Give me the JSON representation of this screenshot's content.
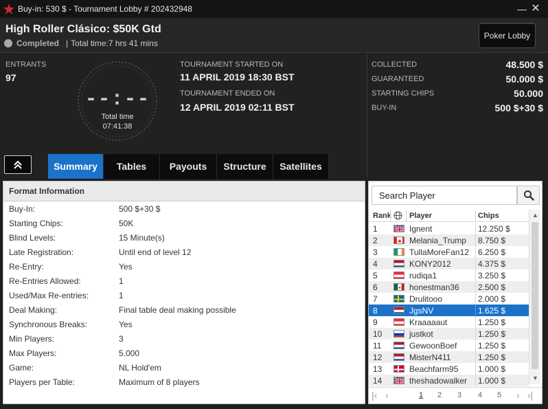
{
  "window": {
    "title": "Buy-in: 530 $ - Tournament Lobby # 202432948",
    "minimize": "—",
    "close": "✕"
  },
  "header": {
    "tournament_name": "High Roller Clásico: $50K Gtd",
    "status": "Completed",
    "separator": "|",
    "total_time": "Total time:7 hrs  41 mins",
    "poker_lobby_button": "Poker Lobby"
  },
  "info": {
    "entrants_label": "ENTRANTS",
    "entrants_value": "97",
    "clock_digits": "--:--",
    "clock_label": "Total time",
    "clock_value": "07:41:38",
    "started_label": "TOURNAMENT STARTED ON",
    "started_value": "11 APRIL 2019  18:30 BST",
    "ended_label": "TOURNAMENT ENDED ON",
    "ended_value": "12 APRIL 2019  02:11 BST"
  },
  "stats": [
    {
      "label": "COLLECTED",
      "value": "48.500 $"
    },
    {
      "label": "GUARANTEED",
      "value": "50.000 $"
    },
    {
      "label": "STARTING CHIPS",
      "value": "50.000"
    },
    {
      "label": "BUY-IN",
      "value": "500 $+30 $"
    }
  ],
  "tabs": [
    {
      "label": "Summary",
      "active": true
    },
    {
      "label": "Tables"
    },
    {
      "label": "Payouts"
    },
    {
      "label": "Structure"
    },
    {
      "label": "Satellites"
    }
  ],
  "format": {
    "title": "Format Information",
    "rows": [
      {
        "key": "Buy-In:",
        "value": "500 $+30 $"
      },
      {
        "key": "Starting Chips:",
        "value": "50K"
      },
      {
        "key": "Blind Levels:",
        "value": "15 Minute(s)"
      },
      {
        "key": "Late Registration:",
        "value": "Until end of level 12"
      },
      {
        "key": "Re-Entry:",
        "value": "Yes"
      },
      {
        "key": "Re-Entries Allowed:",
        "value": "1"
      },
      {
        "key": "Used/Max Re-entries:",
        "value": "1"
      },
      {
        "key": "Deal Making:",
        "value": "Final table deal making possible"
      },
      {
        "key": "Synchronous Breaks:",
        "value": "Yes"
      },
      {
        "key": "Min Players:",
        "value": "3"
      },
      {
        "key": "Max Players:",
        "value": "5.000"
      },
      {
        "key": "Game:",
        "value": "NL Hold'em"
      },
      {
        "key": "Players per Table:",
        "value": "Maximum of 8 players"
      }
    ]
  },
  "players": {
    "search_placeholder": "Search Player",
    "columns": {
      "rank": "Rank",
      "player": "Player",
      "chips": "Chips"
    },
    "rows": [
      {
        "rank": "1",
        "flag": "gb",
        "name": "Ignent",
        "chips": "12.250 $"
      },
      {
        "rank": "2",
        "flag": "ca",
        "name": "Melania_Trump",
        "chips": "8.750 $"
      },
      {
        "rank": "3",
        "flag": "ie",
        "name": "TullaMoreFan12",
        "chips": "6.250 $"
      },
      {
        "rank": "4",
        "flag": "nl",
        "name": "KONY2012",
        "chips": "4.375 $"
      },
      {
        "rank": "5",
        "flag": "at",
        "name": "rudiqa1",
        "chips": "3.250 $"
      },
      {
        "rank": "6",
        "flag": "mx",
        "name": "honestman36",
        "chips": "2.500 $"
      },
      {
        "rank": "7",
        "flag": "se",
        "name": "Drulitooo",
        "chips": "2.000 $"
      },
      {
        "rank": "8",
        "flag": "nl",
        "name": "JgsNV",
        "chips": "1.625 $",
        "selected": true
      },
      {
        "rank": "9",
        "flag": "at",
        "name": "Kraaaaaut",
        "chips": "1.250 $"
      },
      {
        "rank": "10",
        "flag": "ru",
        "name": "justkot",
        "chips": "1.250 $"
      },
      {
        "rank": "11",
        "flag": "nl",
        "name": "GewoonBoef",
        "chips": "1.250 $"
      },
      {
        "rank": "12",
        "flag": "nl",
        "name": "MisterN411",
        "chips": "1.250 $"
      },
      {
        "rank": "13",
        "flag": "dk",
        "name": "Beachfarm95",
        "chips": "1.000 $"
      },
      {
        "rank": "14",
        "flag": "gb",
        "name": "theshadowalker",
        "chips": "1.000 $"
      }
    ],
    "pages": [
      "1",
      "2",
      "3",
      "4",
      "5"
    ],
    "current_page": "1"
  },
  "colors": {
    "accent": "#1a73c9",
    "background": "#1f1f1f",
    "logo_red": "#d7262b"
  }
}
